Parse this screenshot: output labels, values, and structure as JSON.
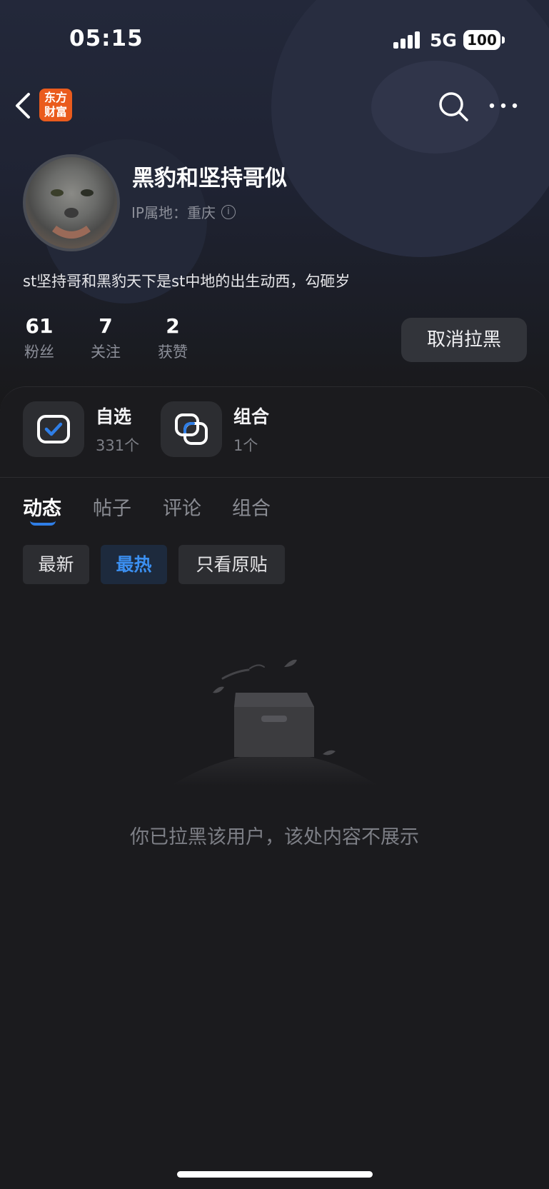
{
  "status_bar": {
    "time": "05:15",
    "network": "5G",
    "battery": "100"
  },
  "nav": {
    "logo_text_line1": "东方",
    "logo_text_line2": "财富"
  },
  "profile": {
    "username": "黑豹和坚持哥似",
    "ip_location": "IP属地：重庆",
    "bio": "st坚持哥和黑豹天下是st中地的出生动西，勾砸岁",
    "stats": [
      {
        "value": "61",
        "label": "粉丝"
      },
      {
        "value": "7",
        "label": "关注"
      },
      {
        "value": "2",
        "label": "获赞"
      }
    ],
    "unblock_label": "取消拉黑"
  },
  "assets": [
    {
      "title": "自选",
      "count": "331个",
      "icon": "checkbox-icon"
    },
    {
      "title": "组合",
      "count": "1个",
      "icon": "overlap-squares-icon"
    }
  ],
  "tabs": [
    {
      "label": "动态",
      "active": true
    },
    {
      "label": "帖子",
      "active": false
    },
    {
      "label": "评论",
      "active": false
    },
    {
      "label": "组合",
      "active": false
    }
  ],
  "filters": [
    {
      "label": "最新",
      "active": false
    },
    {
      "label": "最热",
      "active": true
    },
    {
      "label": "只看原贴",
      "active": false
    }
  ],
  "empty_state": {
    "message": "你已拉黑该用户，该处内容不展示",
    "icon": "empty-box-icon"
  },
  "colors": {
    "accent": "#2f7ee6",
    "background": "#19191b",
    "logo": "#ea5b1d"
  }
}
